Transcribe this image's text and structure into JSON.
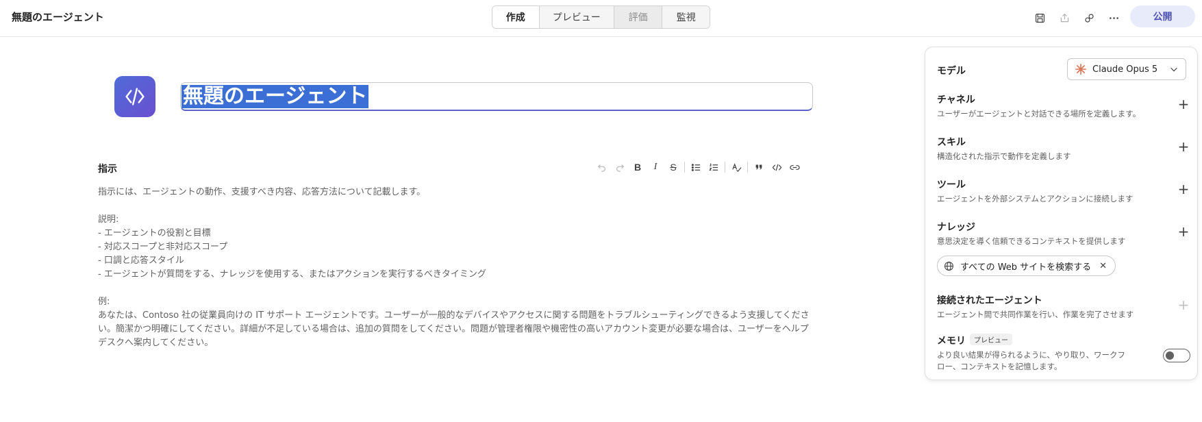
{
  "header": {
    "title": "無題のエージェント",
    "tabs": [
      {
        "label": "作成"
      },
      {
        "label": "プレビュー"
      },
      {
        "label": "評価"
      },
      {
        "label": "監視"
      }
    ],
    "icons": [
      "save-icon",
      "share-icon",
      "link-icon",
      "more-icon"
    ],
    "publish_label": "公開"
  },
  "agent": {
    "name": "無題のエージェント"
  },
  "instructions": {
    "label": "指示",
    "line1": "指示には、エージェントの動作、支援すべき内容、応答方法について記載します。",
    "desc_heading": "説明:",
    "bullets": [
      "- エージェントの役割と目標",
      "- 対応スコープと非対応スコープ",
      "- 口調と応答スタイル",
      "- エージェントが質問をする、ナレッジを使用する、またはアクションを実行するべきタイミング"
    ],
    "example_heading": "例:",
    "example_text": "あなたは、Contoso 社の従業員向けの IT サポート エージェントです。ユーザーが一般的なデバイスやアクセスに関する問題をトラブルシューティングできるよう支援してください。簡潔かつ明確にしてください。詳細が不足している場合は、追加の質問をしてください。問題が管理者権限や機密性の高いアカウント変更が必要な場合は、ユーザーをヘルプ デスクへ案内してください。",
    "toolbar": {
      "bold": "B",
      "italic": "I",
      "strike": "S"
    }
  },
  "panel": {
    "model_label": "モデル",
    "model_value": "Claude Opus 5",
    "sections": [
      {
        "title": "チャネル",
        "desc": "ユーザーがエージェントと対話できる場所を定義します。"
      },
      {
        "title": "スキル",
        "desc": "構造化された指示で動作を定義します"
      },
      {
        "title": "ツール",
        "desc": "エージェントを外部システムとアクションに接続します"
      },
      {
        "title": "ナレッジ",
        "desc": "意思決定を導く信頼できるコンテキストを提供します"
      }
    ],
    "knowledge_chip": "すべての Web サイトを検索する",
    "connected": {
      "title": "接続されたエージェント",
      "desc": "エージェント間で共同作業を行い、作業を完了させます"
    },
    "memory": {
      "title": "メモリ",
      "badge": "プレビュー",
      "desc": "より良い結果が得られるように、やり取り、ワークフロー、コンテキストを記憶します。",
      "enabled": false
    }
  },
  "colors": {
    "accent": "#4f52b2",
    "selection": "#3b6fd6",
    "avatar_gradient_start": "#4f6bd8",
    "avatar_gradient_end": "#6a4fd0",
    "claude_spark": "#d97757"
  }
}
